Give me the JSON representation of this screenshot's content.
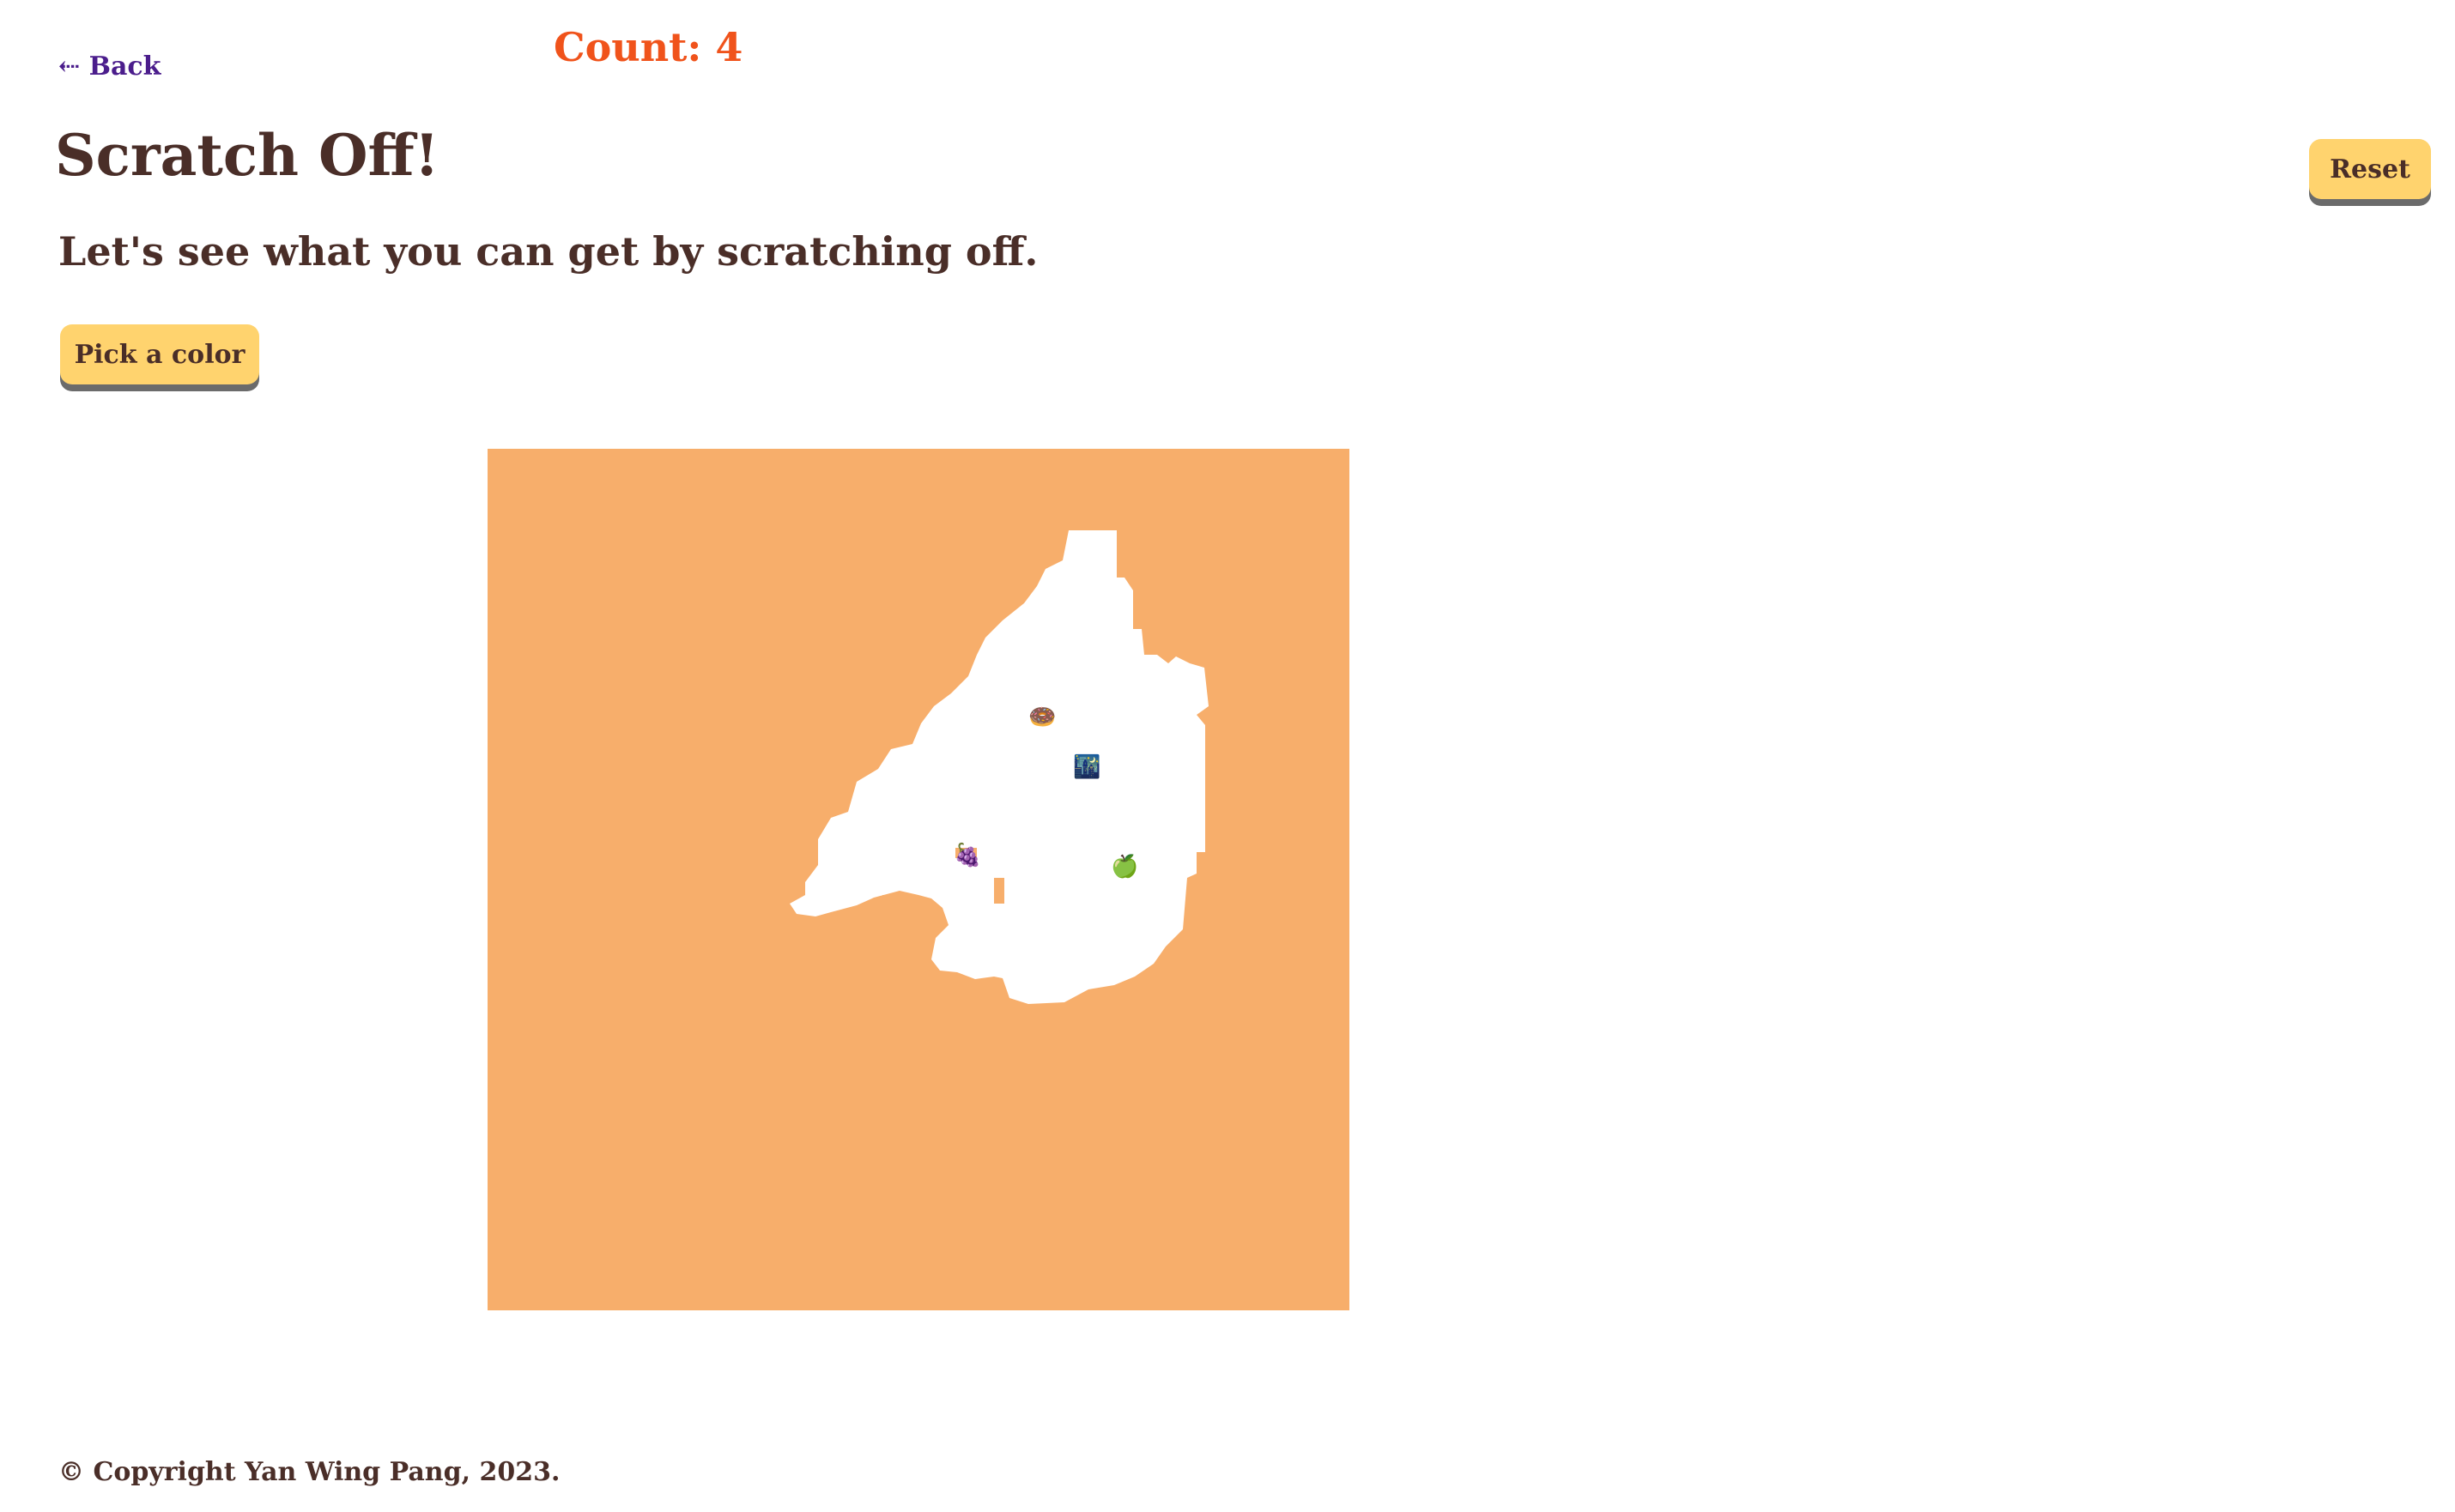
{
  "nav": {
    "back_label": "⇠ Back"
  },
  "game": {
    "count_text": "Count: 4",
    "title": "Scratch Off!",
    "subtitle": "Let's see what you can get by scratching off.",
    "pick_color_label": "Pick a color",
    "reset_label": "Reset",
    "cover_color": "#f7ae6b",
    "revealed_color": "#ffffff",
    "prizes": [
      {
        "name": "donut",
        "glyph": "🍩"
      },
      {
        "name": "night-city",
        "glyph": "🌃"
      },
      {
        "name": "grapes",
        "glyph": "🍇"
      },
      {
        "name": "green-apple",
        "glyph": "🍏"
      }
    ]
  },
  "footer": {
    "copyright": "© Copyright Yan Wing Pang, 2023."
  }
}
